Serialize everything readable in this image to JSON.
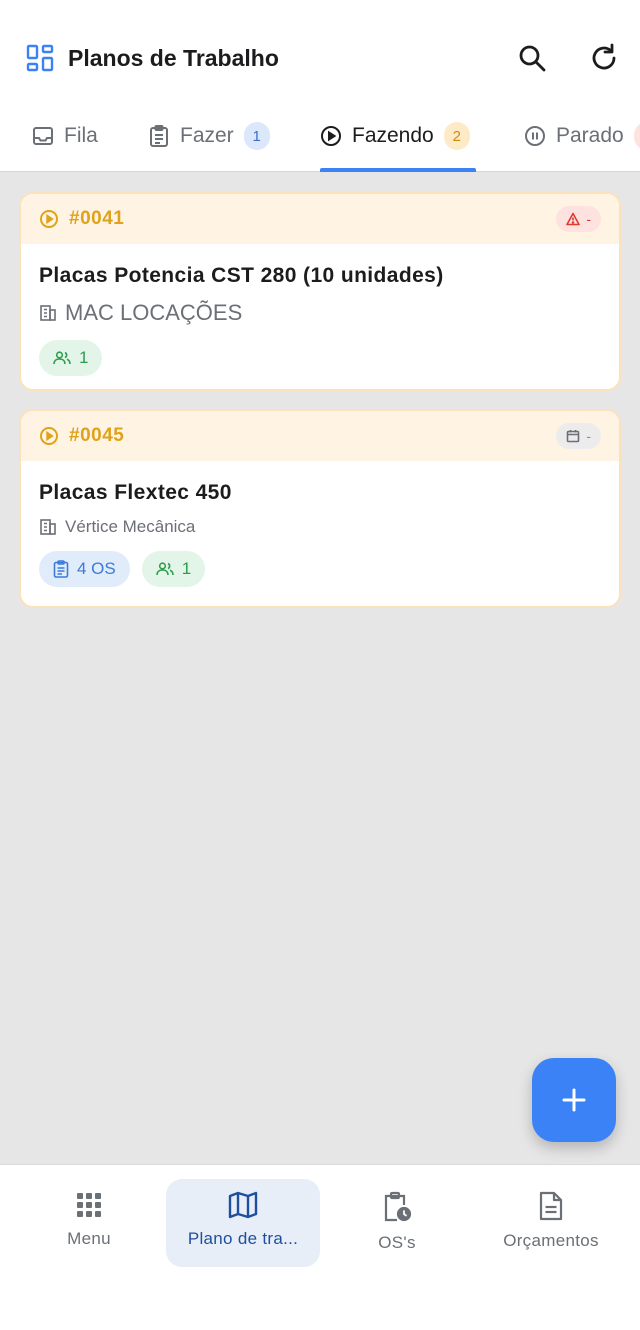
{
  "app": {
    "title": "Planos de Trabalho",
    "accent": "#3b82f6"
  },
  "tabs": [
    {
      "label": "Fila",
      "icon": "inbox-icon",
      "badge": null
    },
    {
      "label": "Fazer",
      "icon": "clipboard-list-icon",
      "badge": "1"
    },
    {
      "label": "Fazendo",
      "icon": "play-circle-icon",
      "badge": "2",
      "active": true
    },
    {
      "label": "Parado",
      "icon": "pause-circle-icon",
      "badge": null
    }
  ],
  "cards": [
    {
      "code": "#0041",
      "status_icon": "warning-icon",
      "status_text": "-",
      "title": "Placas Potencia CST 280 (10 unidades)",
      "client": "MAC LOCAÇÕES",
      "people_count": "1"
    },
    {
      "code": "#0045",
      "status_icon": "calendar-icon",
      "status_text": "-",
      "title": "Placas Flextec 450",
      "client": "Vértice Mecânica",
      "os_count": "4 OS",
      "people_count": "1"
    }
  ],
  "fab": {
    "icon": "plus-icon"
  },
  "nav": [
    {
      "label": "Menu",
      "icon": "grid-icon"
    },
    {
      "label": "Plano de tra...",
      "icon": "map-icon",
      "active": true
    },
    {
      "label": "OS's",
      "icon": "clipboard-clock-icon"
    },
    {
      "label": "Orçamentos",
      "icon": "document-icon"
    }
  ]
}
